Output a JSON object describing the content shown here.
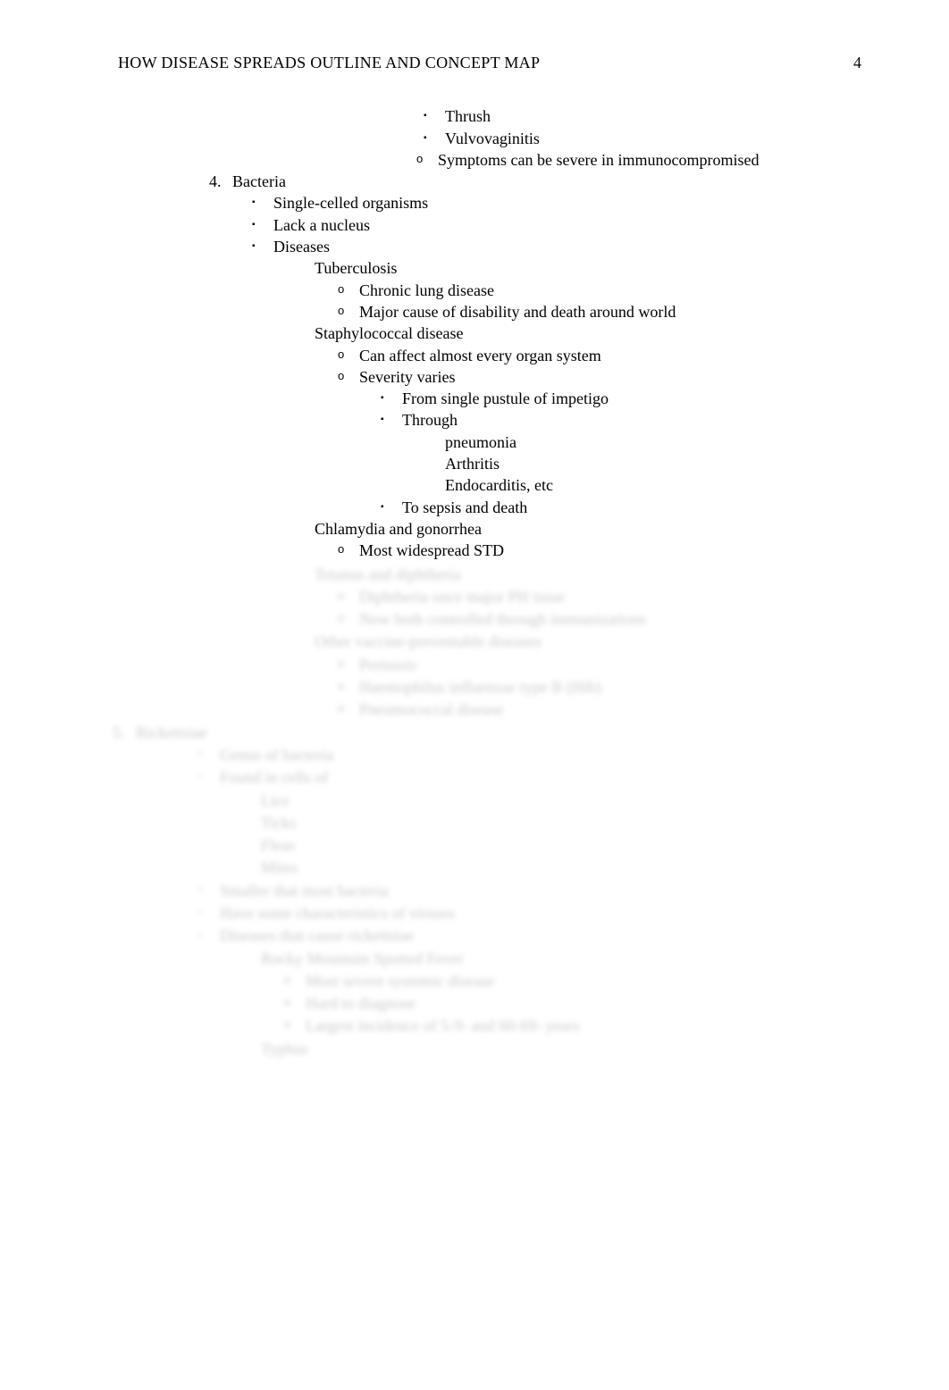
{
  "header": {
    "title": "HOW DISEASE SPREADS OUTLINE AND CONCEPT MAP",
    "page_number": "4"
  },
  "outline": {
    "continuation_top": {
      "items": [
        "Thrush",
        "Vulvovaginitis"
      ],
      "symptoms_note": "Symptoms can be severe in immunocompromised"
    },
    "section_4": {
      "number": "4.",
      "label": "Bacteria",
      "bullets": [
        "Single-celled organisms",
        "Lack a nucleus"
      ],
      "diseases_label": "Diseases",
      "diseases": {
        "tuberculosis": {
          "label": "Tuberculosis",
          "points": [
            "Chronic lung disease",
            "Major cause of disability and death around world"
          ]
        },
        "staph": {
          "label": "Staphylococcal disease",
          "points_intro": [
            "Can affect almost every organ system",
            "Severity varies"
          ],
          "severity": {
            "from": "From single pustule of impetigo",
            "through_label": "Through",
            "through_items": [
              "pneumonia",
              "Arthritis",
              "Endocarditis, etc"
            ],
            "to": "To sepsis and death"
          }
        },
        "chlamydia": {
          "label": "Chlamydia and gonorrhea",
          "points": [
            "Most widespread STD"
          ]
        }
      }
    }
  },
  "blurred_preview": {
    "group_a": {
      "title": "Tetanus and diphtheria",
      "points": [
        "Diphtheria once major PH issue",
        "Now both controlled through immunizations"
      ]
    },
    "group_b": {
      "title": "Other vaccine-preventable diseases",
      "points": [
        "Pertussis",
        "Haemophilus influenzae type B (Hib)",
        "Pneumococcal disease"
      ]
    },
    "section_5": {
      "number": "5.",
      "label": "Rickettsiae",
      "bullets": [
        "Genus of bacteria",
        {
          "label": "Found in cells of",
          "items": [
            "Lice",
            "Ticks",
            "Fleas",
            "Mites"
          ]
        },
        "Smaller that most bacteria",
        "Have some characteristics of viruses",
        {
          "label": "Diseases that cause rickettsiae",
          "children": [
            {
              "label": "Rocky Mountain Spotted Fever",
              "points": [
                "Most severe systemic disease",
                "Hard to diagnose",
                "Largest incidence of 5-9- and 60-69- years"
              ]
            },
            {
              "label": "Typhus"
            }
          ]
        }
      ]
    }
  }
}
